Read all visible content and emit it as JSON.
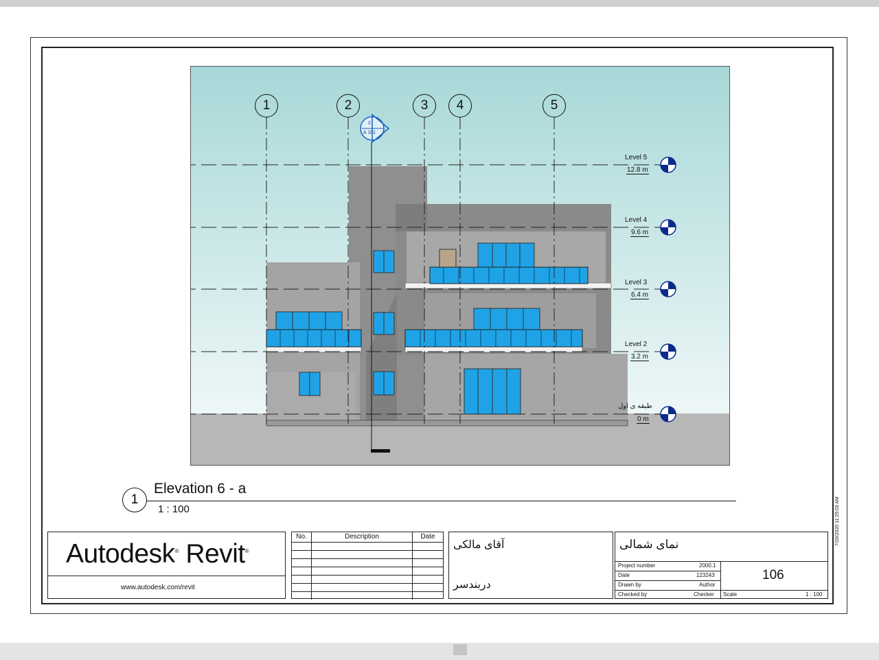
{
  "elevation": {
    "grids": [
      "1",
      "2",
      "3",
      "4",
      "5"
    ],
    "levels": [
      {
        "name": "Level 5",
        "elevation": "12.8 m"
      },
      {
        "name": "Level 4",
        "elevation": "9.6 m"
      },
      {
        "name": "Level 3",
        "elevation": "6.4 m"
      },
      {
        "name": "Level 2",
        "elevation": "3.2 m"
      },
      {
        "name": "طبقه ی اول",
        "elevation": "0 m"
      }
    ],
    "section_tag": {
      "number": "2",
      "sheet": "A 101"
    },
    "colors": {
      "sky": "#c8e6e6",
      "ground": "#b9b9b9",
      "glass": "#1fa3e6",
      "wall": "#9a9a9a"
    }
  },
  "view": {
    "number": "1",
    "title": "Elevation 6 - a",
    "scale": "1 : 100"
  },
  "logo": {
    "brand": "Autodesk",
    "product": "Revit",
    "url": "www.autodesk.com/revit"
  },
  "revisions": {
    "headers": [
      "No.",
      "Description",
      "Date"
    ]
  },
  "client": {
    "owner": "آقای مالکی",
    "location": "دربندسر"
  },
  "sheet": {
    "name": "نمای شمالی",
    "number": "106",
    "fields": [
      {
        "label": "Project number",
        "value": "2000.1"
      },
      {
        "label": "Date",
        "value": "123243"
      },
      {
        "label": "Drawn by",
        "value": "Author"
      },
      {
        "label": "Checked by",
        "value": "Checker"
      }
    ],
    "scale_label": "Scale",
    "scale_value": "1 : 100",
    "timestamp": "7/20/2020 11:25:03 AM"
  }
}
